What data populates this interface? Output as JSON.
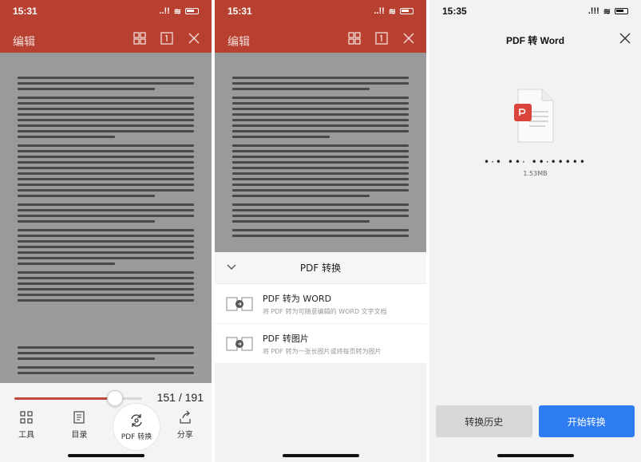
{
  "status_bar": [
    {
      "time": "15:31",
      "carrier": "..!!"
    },
    {
      "time": "15:31",
      "carrier": "..!!"
    },
    {
      "time": "15:35",
      "carrier": ".!!!"
    }
  ],
  "editor": {
    "title": "编辑",
    "page_current": "151",
    "page_total": "191",
    "page_separator": "/",
    "page_progress": 0.79,
    "tools": [
      {
        "label": "工具",
        "icon": "grid-icon"
      },
      {
        "label": "目录",
        "icon": "catalog-icon"
      },
      {
        "label": "PDF 转换",
        "icon": "convert-icon"
      },
      {
        "label": "分享",
        "icon": "share-icon"
      }
    ]
  },
  "convert_sheet": {
    "title": "PDF 转换",
    "options": [
      {
        "title": "PDF 转为 WORD",
        "desc": "将 PDF 转为可随意编辑的 WORD 文字文档",
        "icon": "pdf-to-word-icon"
      },
      {
        "title": "PDF 转图片",
        "desc": "将 PDF 转为一张长图片或将每页转为图片",
        "icon": "pdf-to-image-icon"
      }
    ]
  },
  "convert_page": {
    "title": "PDF 转 Word",
    "file_name": "•·•  ••·  ••·•••••",
    "file_size": "1.53MB",
    "history_button": "转换历史",
    "start_button": "开始转换"
  },
  "colors": {
    "header_red": "#b74030",
    "accent_blue": "#2d7cf2",
    "slider_red": "#c24a3c"
  }
}
